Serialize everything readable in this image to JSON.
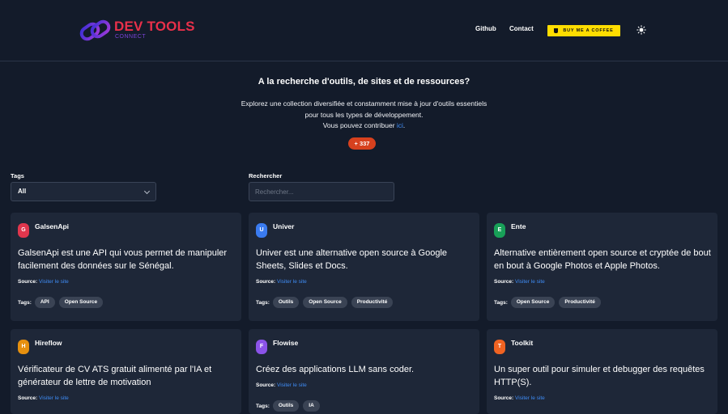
{
  "brand": {
    "title": "DEV TOOLS",
    "subtitle": "CONNECT",
    "colors": {
      "title": "#e8304a",
      "logo_start": "#3b2fd6",
      "logo_end": "#a23ad9"
    }
  },
  "nav": {
    "github": "Github",
    "contact": "Contact",
    "coffee": "BUY ME A COFFEE",
    "theme_icon": "sun-icon"
  },
  "hero": {
    "title": "A la recherche d'outils, de sites et de ressources?",
    "line1": "Explorez une collection diversifiée et constamment mise à jour d'outils essentiels",
    "line2": "pour tous les types de développement.",
    "line3_prefix": "Vous pouvez contribuer ",
    "line3_link": "ici",
    "line3_suffix": ".",
    "count": "+ 337"
  },
  "filters": {
    "tags_label": "Tags",
    "tags_value": "All",
    "search_label": "Rechercher",
    "search_placeholder": "Rechercher..."
  },
  "common": {
    "source_label": "Source:",
    "visit_label": "Visiter le site",
    "tags_label": "Tags:"
  },
  "cards": [
    {
      "letter": "G",
      "color": "#e0364d",
      "name": "GalsenApi",
      "desc": "GalsenApi est une API qui vous permet de manipuler facilement des données sur le Sénégal.",
      "tags": [
        "API",
        "Open Source"
      ]
    },
    {
      "letter": "U",
      "color": "#3a7bf0",
      "name": "Univer",
      "desc": "Univer est une alternative open source à Google Sheets, Slides et Docs.",
      "tags": [
        "Outils",
        "Open Source",
        "Productivité"
      ]
    },
    {
      "letter": "E",
      "color": "#18a058",
      "name": "Ente",
      "desc": "Alternative entièrement open source et cryptée de bout en bout à Google Photos et Apple Photos.",
      "tags": [
        "Open Source",
        "Productivité"
      ]
    },
    {
      "letter": "H",
      "color": "#e6900f",
      "name": "Hireflow",
      "desc": "Vérificateur de CV ATS gratuit alimenté par l'IA et générateur de lettre de motivation",
      "tags": []
    },
    {
      "letter": "F",
      "color": "#8b53e8",
      "name": "Flowise",
      "desc": "Créez des applications LLM sans coder.",
      "tags": [
        "Outils",
        "IA"
      ]
    },
    {
      "letter": "T",
      "color": "#f06322",
      "name": "Toolkit",
      "desc": "Un super outil pour simuler et debugger des requêtes HTTP(S).",
      "tags": []
    }
  ]
}
